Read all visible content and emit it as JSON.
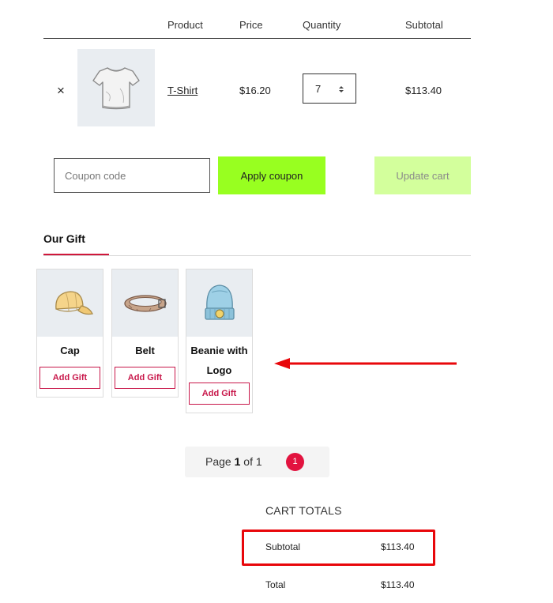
{
  "cart_table": {
    "headers": {
      "product": "Product",
      "price": "Price",
      "quantity": "Quantity",
      "subtotal": "Subtotal"
    },
    "rows": [
      {
        "remove_symbol": "×",
        "thumbnail_icon": "tshirt-icon",
        "product": "T-Shirt",
        "price": "$16.20",
        "quantity": "7",
        "subtotal": "$113.40"
      }
    ]
  },
  "coupon": {
    "placeholder": "Coupon code",
    "value": "",
    "apply_label": "Apply coupon",
    "update_label": "Update cart"
  },
  "gift": {
    "tab_label": "Our Gift",
    "items": [
      {
        "name": "Cap",
        "icon": "cap-icon",
        "button": "Add Gift"
      },
      {
        "name": "Belt",
        "icon": "belt-icon",
        "button": "Add Gift"
      },
      {
        "name": "Beanie with Logo",
        "icon": "beanie-icon",
        "button": "Add Gift"
      }
    ]
  },
  "pagination": {
    "prefix": "Page",
    "current": "1",
    "of": "of",
    "total": "1",
    "badge": "1"
  },
  "cart_totals": {
    "title": "CART TOTALS",
    "subtotal_label": "Subtotal",
    "subtotal_value": "$113.40",
    "total_label": "Total",
    "total_value": "$113.40"
  },
  "colors": {
    "apply_button": "#98ff20",
    "update_button": "#d3ff9c",
    "accent": "#c8174a",
    "highlight": "#e8070b"
  }
}
